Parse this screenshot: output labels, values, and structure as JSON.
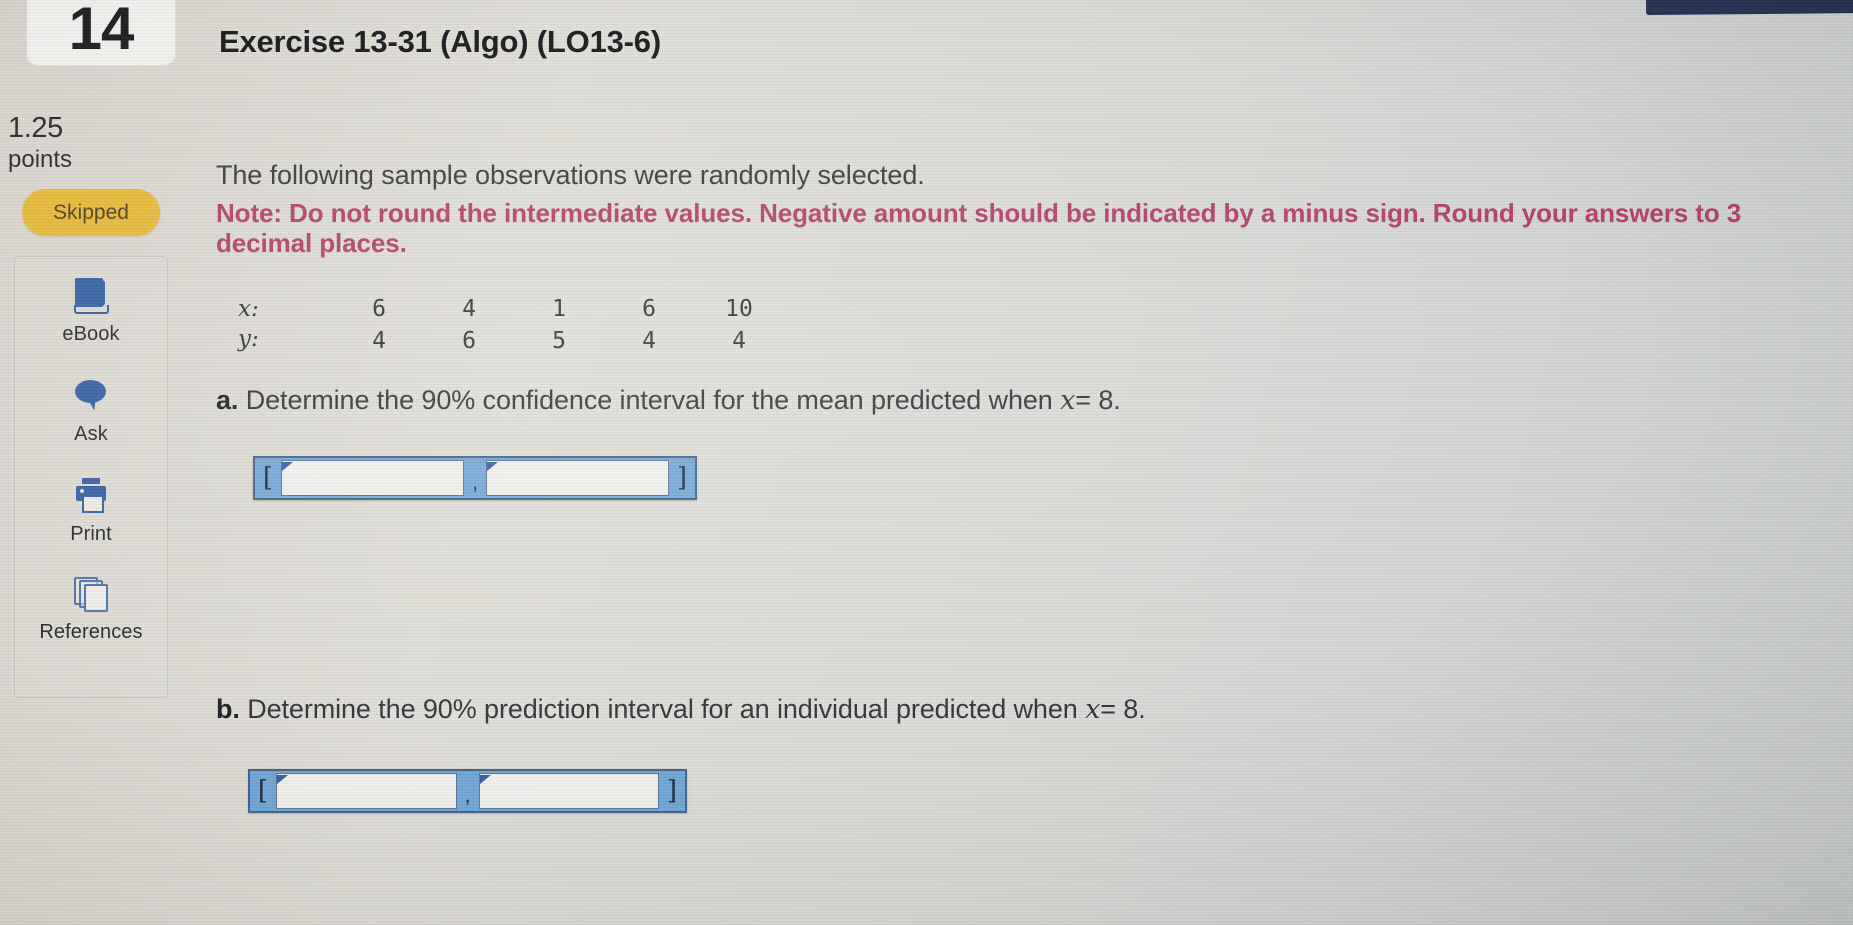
{
  "window": {
    "question_number": "14"
  },
  "sidebar": {
    "points_value": "1.25",
    "points_label": "points",
    "status_badge": "Skipped",
    "status_badge_color": "#e8b832",
    "tools": [
      {
        "icon": "book-icon",
        "label": "eBook"
      },
      {
        "icon": "speech-bubble-icon",
        "label": "Ask"
      },
      {
        "icon": "printer-icon",
        "label": "Print"
      },
      {
        "icon": "copy-pages-icon",
        "label": "References"
      }
    ]
  },
  "exercise": {
    "title": "Exercise 13-31 (Algo) (LO13-6)",
    "intro": "The following sample observations were randomly selected.",
    "note": "Note: Do not round the intermediate values. Negative amount should be indicated by a minus sign. Round your answers to 3 decimal places.",
    "note_color": "#b03a62"
  },
  "data_table": {
    "row_labels": [
      "x:",
      "y:"
    ],
    "x": [
      "6",
      "4",
      "1",
      "6",
      "10"
    ],
    "y": [
      "4",
      "6",
      "5",
      "4",
      "4"
    ]
  },
  "questions": [
    {
      "marker": "a.",
      "text_before": " Determine the 90% confidence interval for the mean predicted when ",
      "variable": "x",
      "equals": "= 8",
      "period": "."
    },
    {
      "marker": "b.",
      "text_before": " Determine the 90% prediction interval for an individual predicted when ",
      "variable": "x",
      "equals": "= 8",
      "period": "."
    }
  ],
  "answers": {
    "open_bracket": "[",
    "separator": ",",
    "close_bracket": "]",
    "a_lower_value": "",
    "a_upper_value": "",
    "b_lower_value": "",
    "b_upper_value": "",
    "field_placeholder": "",
    "accent_color": "#6fa5d6"
  }
}
